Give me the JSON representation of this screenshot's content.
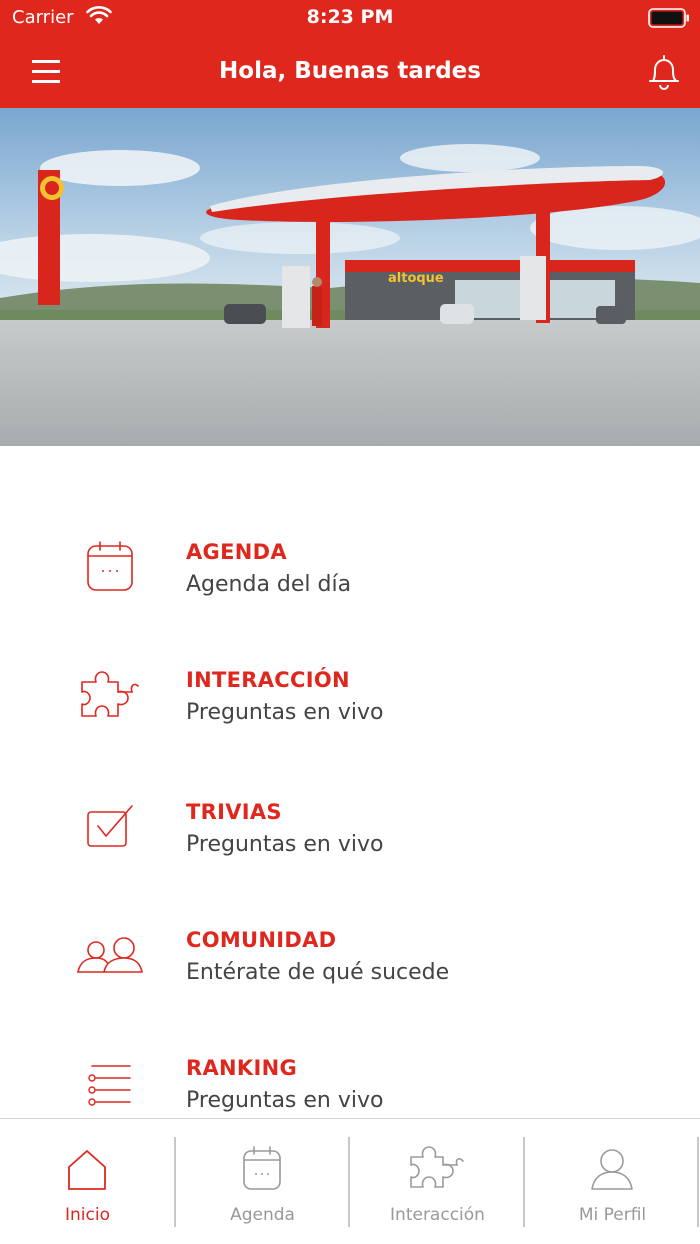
{
  "status_bar": {
    "carrier": "Carrier",
    "time": "8:23 PM"
  },
  "header": {
    "title": "Hola, Buenas tardes"
  },
  "colors": {
    "brand": "#e0271e",
    "text": "#444444",
    "inactive": "#999999"
  },
  "menu": [
    {
      "label": "AGENDA",
      "subtitle": "Agenda del día",
      "icon": "calendar-icon"
    },
    {
      "label": "INTERACCIÓN",
      "subtitle": "Preguntas en vivo",
      "icon": "puzzle-icon"
    },
    {
      "label": "TRIVIAS",
      "subtitle": "Preguntas en vivo",
      "icon": "checkbox-icon"
    },
    {
      "label": "COMUNIDAD",
      "subtitle": "Entérate de qué sucede",
      "icon": "users-icon"
    },
    {
      "label": "RANKING",
      "subtitle": "Preguntas en vivo",
      "icon": "list-icon"
    }
  ],
  "tabs": [
    {
      "label": "Inicio",
      "icon": "home-icon",
      "active": true
    },
    {
      "label": "Agenda",
      "icon": "calendar-icon",
      "active": false
    },
    {
      "label": "Interacción",
      "icon": "puzzle-icon",
      "active": false
    },
    {
      "label": "Mi Perfil",
      "icon": "user-icon",
      "active": false
    }
  ],
  "hero": {
    "sign_text": "altoque"
  }
}
